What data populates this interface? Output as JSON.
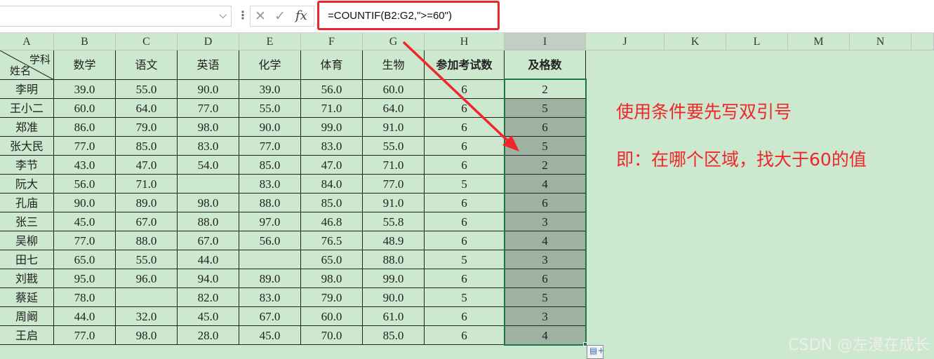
{
  "formula_bar": {
    "name_box": "",
    "dropdown_icon": "chevron-down-icon",
    "separator_icon": "more-vertical-icon",
    "cancel_icon": "close-icon",
    "confirm_icon": "check-icon",
    "fx_label": "fx",
    "formula": "=COUNTIF(B2:G2,\">=60\")",
    "highlight_color": "#e8262b"
  },
  "columns": [
    "A",
    "B",
    "C",
    "D",
    "E",
    "F",
    "G",
    "H",
    "I",
    "J",
    "K",
    "L",
    "M",
    "N"
  ],
  "active_column": "I",
  "header_row": {
    "diag_top": "学科",
    "diag_bottom": "姓名",
    "subjects": [
      "数学",
      "语文",
      "英语",
      "化学",
      "体育",
      "生物"
    ],
    "exam_count": "参加考试数",
    "pass_count": "及格数"
  },
  "rows": [
    {
      "name": "李明",
      "scores": [
        "39.0",
        "55.0",
        "90.0",
        "39.0",
        "56.0",
        "60.0"
      ],
      "exams": "6",
      "passed": "2"
    },
    {
      "name": "王小二",
      "scores": [
        "60.0",
        "64.0",
        "77.0",
        "55.0",
        "71.0",
        "64.0"
      ],
      "exams": "6",
      "passed": "5"
    },
    {
      "name": "郑准",
      "scores": [
        "86.0",
        "79.0",
        "98.0",
        "90.0",
        "99.0",
        "91.0"
      ],
      "exams": "6",
      "passed": "6"
    },
    {
      "name": "张大民",
      "scores": [
        "77.0",
        "85.0",
        "83.0",
        "77.0",
        "83.0",
        "55.0"
      ],
      "exams": "6",
      "passed": "5"
    },
    {
      "name": "李节",
      "scores": [
        "43.0",
        "47.0",
        "54.0",
        "85.0",
        "47.0",
        "71.0"
      ],
      "exams": "6",
      "passed": "2"
    },
    {
      "name": "阮大",
      "scores": [
        "56.0",
        "71.0",
        "",
        "83.0",
        "84.0",
        "77.0"
      ],
      "exams": "5",
      "passed": "4"
    },
    {
      "name": "孔庙",
      "scores": [
        "90.0",
        "89.0",
        "98.0",
        "88.0",
        "85.0",
        "91.0"
      ],
      "exams": "6",
      "passed": "6"
    },
    {
      "name": "张三",
      "scores": [
        "45.0",
        "67.0",
        "88.0",
        "97.0",
        "46.8",
        "55.8"
      ],
      "exams": "6",
      "passed": "3"
    },
    {
      "name": "吴柳",
      "scores": [
        "77.0",
        "88.0",
        "67.0",
        "56.0",
        "76.5",
        "48.9"
      ],
      "exams": "6",
      "passed": "4"
    },
    {
      "name": "田七",
      "scores": [
        "65.0",
        "55.0",
        "44.0",
        "",
        "65.0",
        "88.0"
      ],
      "exams": "5",
      "passed": "3"
    },
    {
      "name": "刘戡",
      "scores": [
        "95.0",
        "96.0",
        "94.0",
        "89.0",
        "98.0",
        "99.0"
      ],
      "exams": "6",
      "passed": "6"
    },
    {
      "name": "蔡延",
      "scores": [
        "78.0",
        "",
        "82.0",
        "83.0",
        "79.0",
        "90.0"
      ],
      "exams": "5",
      "passed": "5"
    },
    {
      "name": "周阚",
      "scores": [
        "44.0",
        "32.0",
        "45.0",
        "67.0",
        "60.0",
        "61.0"
      ],
      "exams": "6",
      "passed": "3"
    },
    {
      "name": "王启",
      "scores": [
        "77.0",
        "98.0",
        "28.0",
        "45.0",
        "70.0",
        "85.0"
      ],
      "exams": "6",
      "passed": "4"
    }
  ],
  "annotations": {
    "line1": "使用条件要先写双引号",
    "line2": "即：在哪个区域，找大于60的值",
    "color": "#f0262a"
  },
  "paste_options_icon": "paste-options-icon",
  "watermark": "CSDN @左漫在成长",
  "colors": {
    "sheet_background": "#cce8cf",
    "selection_fill": "#9fb1a1",
    "selection_border": "#217346"
  }
}
